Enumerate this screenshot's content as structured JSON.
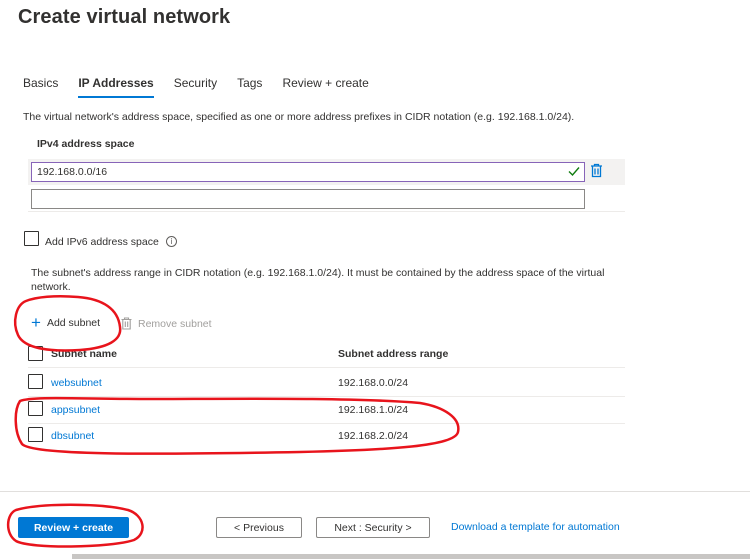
{
  "page": {
    "title": "Create virtual network"
  },
  "tabs": [
    {
      "label": "Basics"
    },
    {
      "label": "IP Addresses"
    },
    {
      "label": "Security"
    },
    {
      "label": "Tags"
    },
    {
      "label": "Review + create"
    }
  ],
  "active_tab": "IP Addresses",
  "address_space": {
    "description": "The virtual network's address space, specified as one or more address prefixes in CIDR notation (e.g. 192.168.1.0/24).",
    "label": "IPv4 address space",
    "values": [
      "192.168.0.0/16",
      ""
    ]
  },
  "ipv6": {
    "label": "Add IPv6 address space",
    "checked": false,
    "info_icon": "i"
  },
  "subnets": {
    "description": "The subnet's address range in CIDR notation (e.g. 192.168.1.0/24). It must be contained by the address space of the virtual network.",
    "add_label": "Add subnet",
    "remove_label": "Remove subnet",
    "columns": [
      "Subnet name",
      "Subnet address range"
    ],
    "rows": [
      {
        "name": "websubnet",
        "range": "192.168.0.0/24"
      },
      {
        "name": "appsubnet",
        "range": "192.168.1.0/24"
      },
      {
        "name": "dbsubnet",
        "range": "192.168.2.0/24"
      }
    ]
  },
  "footer": {
    "review_create": "Review + create",
    "previous": "< Previous",
    "next": "Next : Security >",
    "download": "Download a template for automation"
  },
  "colors": {
    "accent": "#0078d4",
    "annotation": "#e8141c",
    "valid": "#107c10"
  },
  "icons": [
    "check-icon",
    "trash-icon",
    "info-icon",
    "plus-icon"
  ]
}
